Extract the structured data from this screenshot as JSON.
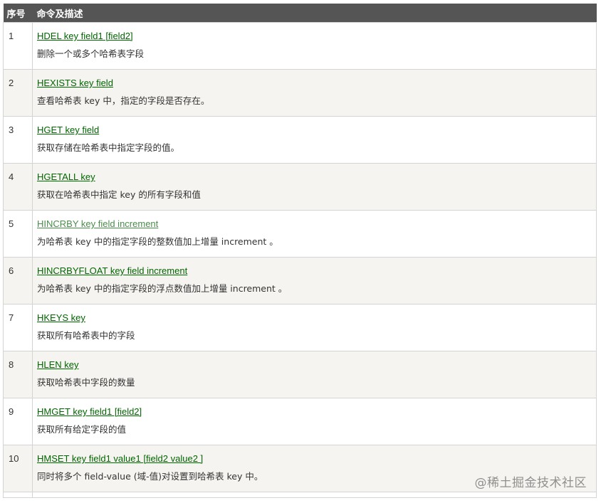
{
  "header": {
    "col_num": "序号",
    "col_cmd": "命令及描述"
  },
  "rows": [
    {
      "num": "1",
      "cmd": "HDEL key field1 [field2]",
      "desc": "删除一个或多个哈希表字段"
    },
    {
      "num": "2",
      "cmd": "HEXISTS key field",
      "desc": "查看哈希表 key 中，指定的字段是否存在。"
    },
    {
      "num": "3",
      "cmd": "HGET key field",
      "desc": "获取存储在哈希表中指定字段的值。"
    },
    {
      "num": "4",
      "cmd": "HGETALL key",
      "desc": "获取在哈希表中指定 key 的所有字段和值"
    },
    {
      "num": "5",
      "cmd": "HINCRBY key field increment",
      "desc": "为哈希表 key 中的指定字段的整数值加上增量 increment 。"
    },
    {
      "num": "6",
      "cmd": "HINCRBYFLOAT key field increment",
      "desc": "为哈希表 key 中的指定字段的浮点数值加上增量 increment 。"
    },
    {
      "num": "7",
      "cmd": "HKEYS key",
      "desc": "获取所有哈希表中的字段"
    },
    {
      "num": "8",
      "cmd": "HLEN key",
      "desc": "获取哈希表中字段的数量"
    },
    {
      "num": "9",
      "cmd": "HMGET key field1 [field2]",
      "desc": "获取所有给定字段的值"
    },
    {
      "num": "10",
      "cmd": "HMSET key field1 value1 [field2 value2 ]",
      "desc": "同时将多个 field-value (域-值)对设置到哈希表 key 中。"
    }
  ],
  "watermark": "@稀土掘金技术社区",
  "colors": {
    "header_bg": "#555555",
    "link": "#006600",
    "alt_row_bg": "#f6f4f0",
    "border": "#d4d4d4"
  }
}
